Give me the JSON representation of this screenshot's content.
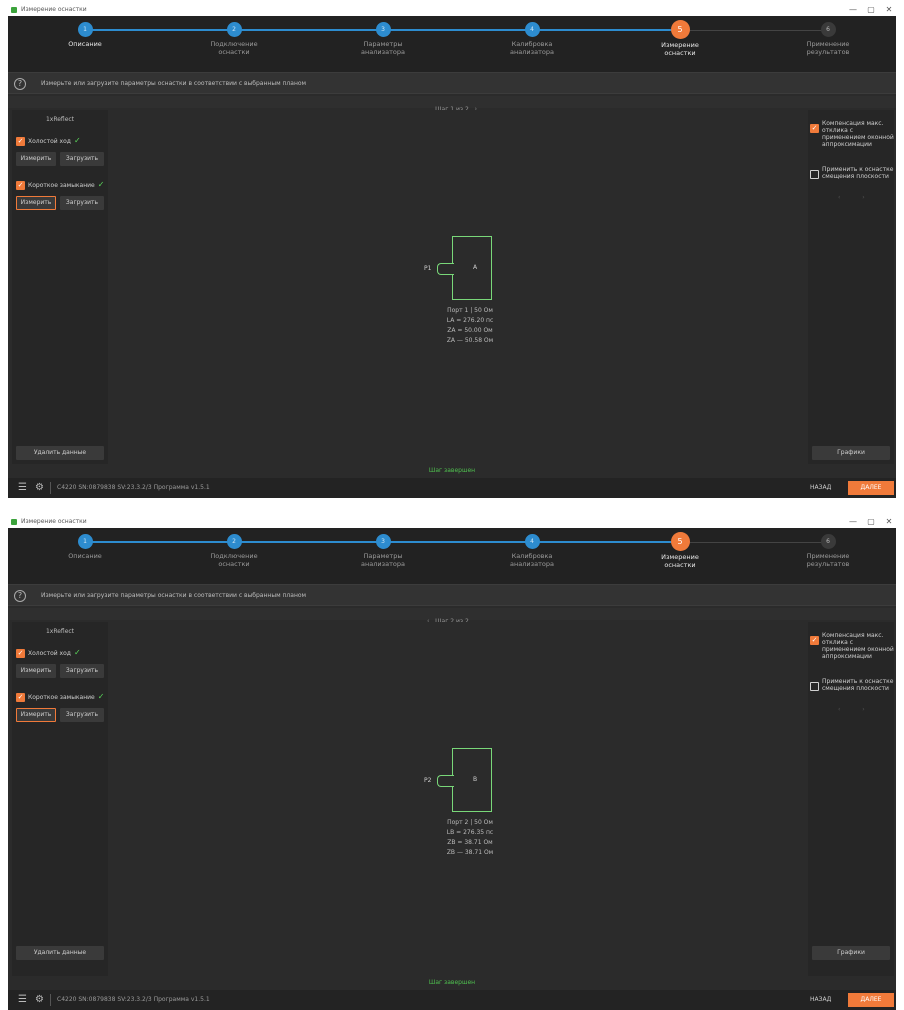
{
  "windows": [
    {
      "title": "Измерение оснастки",
      "controls": [
        "—",
        "▢",
        "✕"
      ],
      "steps": [
        {
          "number": "1",
          "label": "Описание",
          "state": "done"
        },
        {
          "number": "2",
          "label": "Подключение\nоснастки",
          "state": "done"
        },
        {
          "number": "3",
          "label": "Параметры\nанализатора",
          "state": "done"
        },
        {
          "number": "4",
          "label": "Калибровка\nанализатора",
          "state": "done"
        },
        {
          "number": "5",
          "label": "Измерение\nоснастки",
          "state": "current"
        },
        {
          "number": "6",
          "label": "Применение\nрезультатов",
          "state": "todo"
        }
      ],
      "info_text": "Измерьте или загрузите параметры оснастки в соответствии с выбранным планом",
      "step_nav": "Шаг 1 из 2",
      "fixture_name": "1xReflect",
      "open_label": "Холостой ход",
      "short_label": "Короткое замыкание",
      "measure_label": "Измерить",
      "load_label": "Загрузить",
      "delete_label": "Удалить данные",
      "port_label": "P1",
      "device_label": "A",
      "params": [
        "Порт 1 | 50 Ом",
        "LA = 276.20 пс",
        "ZA = 50.00 Ом",
        "ZA — 50.58 Ом"
      ],
      "right_check1": "Компенсация макс. отклика с применением оконной аппроксимации",
      "right_check2": "Применить к оснастке смещения плоскости",
      "graphs_label": "Графики",
      "status": "Шаг завершен",
      "device_info": "C4220 SN:0879838 SV:23.3.2/3 Программа v1.5.1",
      "back_label": "НАЗАД",
      "next_label": "ДАЛЕЕ"
    },
    {
      "title": "Измерение оснастки",
      "controls": [
        "—",
        "▢",
        "✕"
      ],
      "steps": [
        {
          "number": "1",
          "label": "Описание",
          "state": "done"
        },
        {
          "number": "2",
          "label": "Подключение\nоснастки",
          "state": "done"
        },
        {
          "number": "3",
          "label": "Параметры\nанализатора",
          "state": "done"
        },
        {
          "number": "4",
          "label": "Калибровка\nанализатора",
          "state": "done"
        },
        {
          "number": "5",
          "label": "Измерение\nоснастки",
          "state": "current"
        },
        {
          "number": "6",
          "label": "Применение\nрезультатов",
          "state": "todo"
        }
      ],
      "info_text": "Измерьте или загрузите параметры оснастки в соответствии с выбранным планом",
      "step_nav": "Шаг 2 из 2",
      "fixture_name": "1xReflect",
      "open_label": "Холостой ход",
      "short_label": "Короткое замыкание",
      "measure_label": "Измерить",
      "load_label": "Загрузить",
      "delete_label": "Удалить данные",
      "port_label": "P2",
      "device_label": "B",
      "params": [
        "Порт 2 | 50 Ом",
        "LB = 276.35 пс",
        "ZB = 38.71 Ом",
        "ZB — 38.71 Ом"
      ],
      "right_check1": "Компенсация макс. отклика с применением оконной аппроксимации",
      "right_check2": "Применить к оснастке смещения плоскости",
      "graphs_label": "Графики",
      "status": "Шаг завершен",
      "device_info": "C4220 SN:0879838 SV:23.3.2/3 Программа v1.5.1",
      "back_label": "НАЗАД",
      "next_label": "ДАЛЕЕ"
    }
  ],
  "colors": {
    "accent": "#f07a3a",
    "step_done": "#2d8ccf",
    "ok": "#5bd85b",
    "device_outline": "#79d879"
  }
}
